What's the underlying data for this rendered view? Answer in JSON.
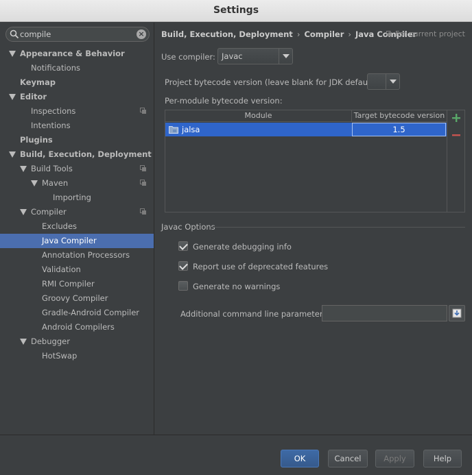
{
  "window": {
    "title": "Settings"
  },
  "search": {
    "value": "compile",
    "placeholder": ""
  },
  "tree": [
    {
      "label": "Appearance & Behavior",
      "bold": true,
      "expanded": true,
      "depth": 0
    },
    {
      "label": "Notifications",
      "depth": 1
    },
    {
      "label": "Keymap",
      "bold": true,
      "depth": 0
    },
    {
      "label": "Editor",
      "bold": true,
      "expanded": true,
      "depth": 0
    },
    {
      "label": "Inspections",
      "depth": 1,
      "project": true
    },
    {
      "label": "Intentions",
      "depth": 1
    },
    {
      "label": "Plugins",
      "bold": true,
      "depth": 0
    },
    {
      "label": "Build, Execution, Deployment",
      "bold": true,
      "expanded": true,
      "depth": 0
    },
    {
      "label": "Build Tools",
      "expanded": true,
      "depth": 1,
      "project": true
    },
    {
      "label": "Maven",
      "expanded": true,
      "depth": 2,
      "project": true
    },
    {
      "label": "Importing",
      "depth": 3
    },
    {
      "label": "Compiler",
      "expanded": true,
      "depth": 1,
      "project": true
    },
    {
      "label": "Excludes",
      "depth": 2
    },
    {
      "label": "Java Compiler",
      "depth": 2,
      "selected": true
    },
    {
      "label": "Annotation Processors",
      "depth": 2
    },
    {
      "label": "Validation",
      "depth": 2
    },
    {
      "label": "RMI Compiler",
      "depth": 2
    },
    {
      "label": "Groovy Compiler",
      "depth": 2
    },
    {
      "label": "Gradle-Android Compiler",
      "depth": 2
    },
    {
      "label": "Android Compilers",
      "depth": 2
    },
    {
      "label": "Debugger",
      "expanded": true,
      "depth": 1
    },
    {
      "label": "HotSwap",
      "depth": 2
    }
  ],
  "breadcrumb": {
    "part1": "Build, Execution, Deployment",
    "part2": "Compiler",
    "part3": "Java Compiler",
    "separator": "›",
    "for_project": "For current project"
  },
  "compiler": {
    "use_label": "Use compiler:",
    "use_value": "Javac",
    "bytecode_label": "Project bytecode version (leave blank for JDK default):",
    "bytecode_value": "",
    "per_module_label": "Per-module bytecode version:"
  },
  "table": {
    "headers": [
      "Module",
      "Target bytecode version"
    ],
    "rows": [
      {
        "module": "jalsa",
        "version": "1.5"
      }
    ]
  },
  "javac": {
    "section_title": "Javac Options",
    "debug_label": "Generate debugging info",
    "debug_checked": true,
    "deprecated_label": "Report use of deprecated features",
    "deprecated_checked": true,
    "nowarn_label": "Generate no warnings",
    "nowarn_checked": false,
    "cmdline_label": "Additional command line parameters:",
    "cmdline_value": ""
  },
  "buttons": {
    "ok": "OK",
    "cancel": "Cancel",
    "apply": "Apply",
    "help": "Help"
  },
  "colors": {
    "selection": "#4b6eaf",
    "row_selection": "#2f65ca",
    "add": "#59a869",
    "remove": "#c75450"
  }
}
